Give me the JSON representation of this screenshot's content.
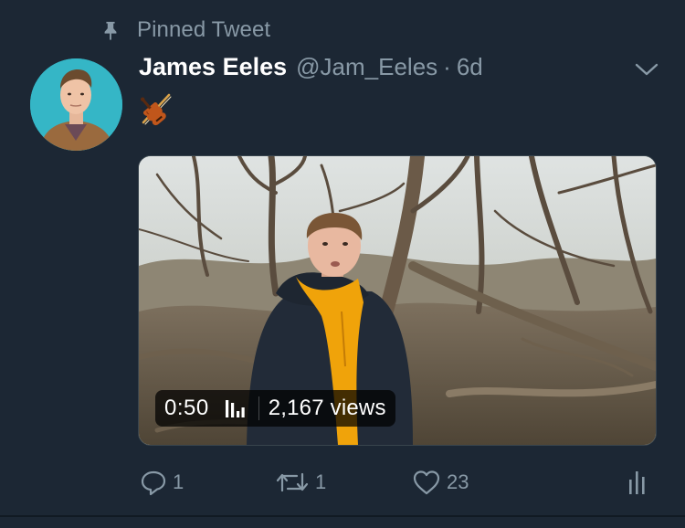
{
  "pinned": {
    "label": "Pinned Tweet",
    "icon": "pin-icon"
  },
  "author": {
    "display_name": "James Eeles",
    "handle": "@Jam_Eeles",
    "separator": "·",
    "timestamp": "6d",
    "avatar": "avatar-image"
  },
  "tweet": {
    "emoji": "violin-emoji",
    "more_icon": "chevron-down-icon"
  },
  "video": {
    "duration": "0:50",
    "views": "2,167 views",
    "views_icon": "bar-chart-icon"
  },
  "actions": {
    "reply": {
      "icon": "reply-icon",
      "count": "1"
    },
    "retweet": {
      "icon": "retweet-icon",
      "count": "1"
    },
    "like": {
      "icon": "heart-icon",
      "count": "23"
    },
    "analytics": {
      "icon": "analytics-icon"
    }
  },
  "colors": {
    "background": "#1c2734",
    "secondary_text": "#8899a6",
    "primary_text": "#ffffff",
    "hoodie": "#f0a30a"
  }
}
